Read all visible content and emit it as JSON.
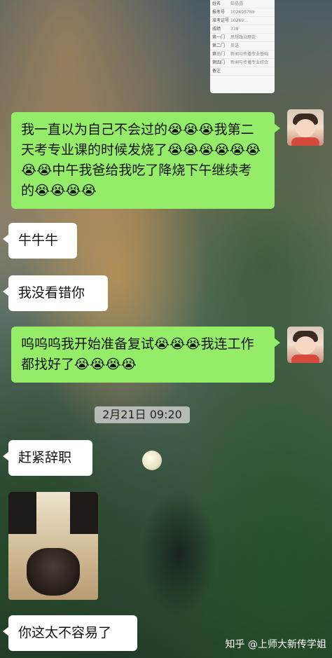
{
  "screenshot_card": {
    "rows": [
      {
        "label": "姓名",
        "value": "彭晶晶"
      },
      {
        "label": "报考号",
        "value": "102698789"
      },
      {
        "label": "准考证号",
        "value": "10269..."
      },
      {
        "label": "成绩",
        "value": "339"
      },
      {
        "label": "第一门",
        "value": "思想政治理论"
      },
      {
        "label": "第二门",
        "value": "英语"
      },
      {
        "label": "第三门",
        "value": "新闻与传播专业基础"
      },
      {
        "label": "第四门",
        "value": "新闻与传播专业综合"
      },
      {
        "label": "备注",
        "value": ""
      }
    ]
  },
  "messages": [
    {
      "side": "right",
      "text": "我一直以为自己不会过的😭😭😭我第二天考专业课的时候发烧了😭😭😭😭😭😭😭😭中午我爸给我吃了降烧下午继续考的😭😭😭😭"
    },
    {
      "side": "left",
      "text": "牛牛牛"
    },
    {
      "side": "left",
      "text": "我没看错你"
    },
    {
      "side": "right",
      "text": "呜呜呜我开始准备复试😭😭😭我连工作都找好了😭😭😭😭"
    },
    {
      "side": "left",
      "text": "赶紧辞职"
    },
    {
      "side": "left",
      "text": "你这太不容易了"
    }
  ],
  "timestamp": "2月21日 09:20",
  "watermark": "知乎 @上师大新传学姐",
  "colors": {
    "sent_bubble": "#95ec69",
    "received_bubble": "#ffffff"
  }
}
